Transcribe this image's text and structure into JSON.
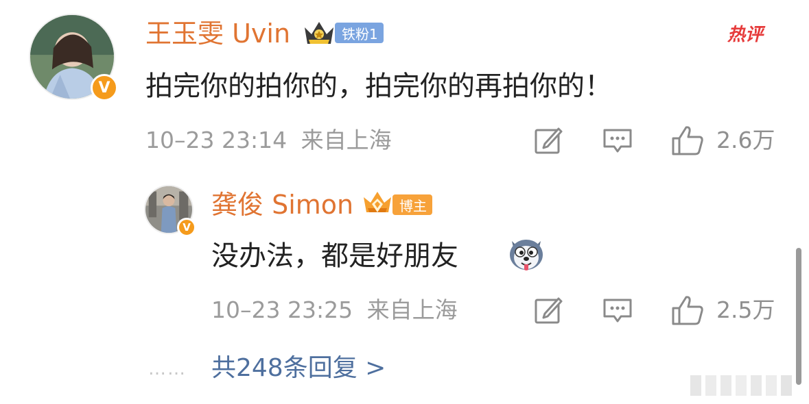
{
  "hot_comment": {
    "tag": "热评",
    "user": {
      "name": "王玉雯 Uvin",
      "badge": "铁粉1",
      "verified_mark": "V"
    },
    "text": "拍完你的拍你的，拍完你的再拍你的！",
    "time": "10–23 23:14",
    "location": "来自上海",
    "likes": "2.6万"
  },
  "reply": {
    "user": {
      "name": "龚俊 Simon",
      "badge": "博主",
      "verified_mark": "V"
    },
    "text": "没办法，都是好朋友",
    "emoji": "husky-emoji",
    "time": "10–23 23:25",
    "location": "来自上海",
    "likes": "2.5万"
  },
  "footer": {
    "dots": "……",
    "more_replies": "共248条回复 >"
  },
  "icons": [
    "edit-icon",
    "comment-icon",
    "thumbs-up-icon",
    "crown-icon"
  ],
  "colors": {
    "username": "#e07432",
    "meta": "#9b9b9b",
    "link": "#4e6f9e",
    "badge_fan": "#7aa4e0",
    "badge_owner": "#f7a23a",
    "hot": "#e63a3a"
  }
}
